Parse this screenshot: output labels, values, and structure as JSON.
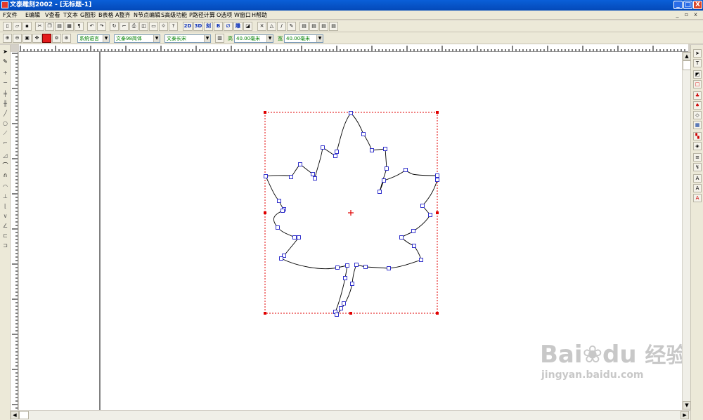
{
  "window": {
    "title": "文泰雕刻2002 - [无标题-1]",
    "controls": {
      "minimize": "_",
      "maximize": "□",
      "close": "X"
    },
    "mdi_controls": {
      "minimize": "_",
      "restore": "▫",
      "close": "x"
    }
  },
  "menu": {
    "items": [
      {
        "label": "F文件"
      },
      {
        "label": "E编辑"
      },
      {
        "label": "V查看"
      },
      {
        "label": "T文本"
      },
      {
        "label": "G图形"
      },
      {
        "label": "B表格"
      },
      {
        "label": "A整齐"
      },
      {
        "label": "N节点编辑"
      },
      {
        "label": "S高级功能"
      },
      {
        "label": "P路径计算"
      },
      {
        "label": "O选项"
      },
      {
        "label": "W窗口"
      },
      {
        "label": "H帮助"
      }
    ]
  },
  "toolbar2": {
    "system_language": "系统语言",
    "font_name": "文泰98简体",
    "font_style": "文泰长宋",
    "height_label": "高",
    "height_value": "40.00毫米",
    "width_label": "宽",
    "width_value": "40.00毫米",
    "text_2d": "2D",
    "text_3d": "3D"
  },
  "watermark": {
    "brand": "Bai",
    "brand_suffix": "du",
    "product": "经验",
    "url": "jingyan.baidu.com"
  },
  "colors": {
    "titlebar": "#0a5fd8",
    "selection": "#e00000",
    "node": "#3333cc"
  }
}
